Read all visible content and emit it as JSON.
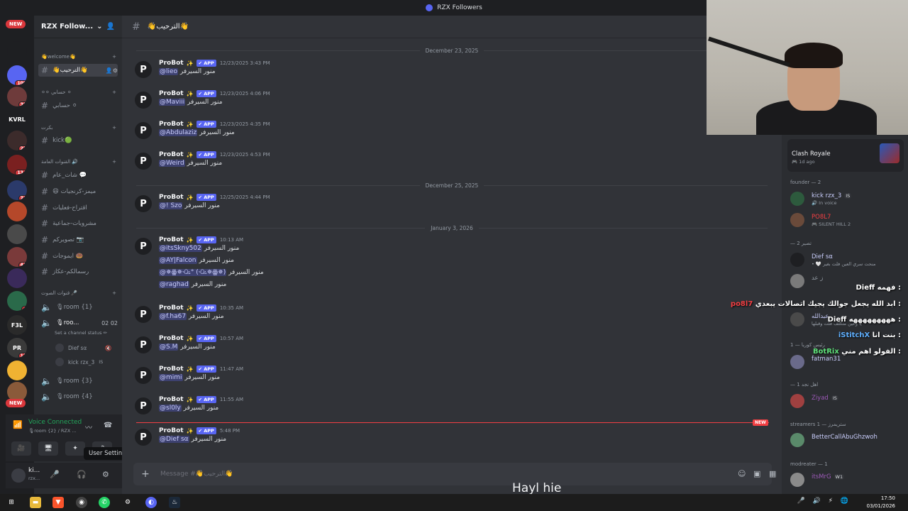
{
  "window": {
    "title": "RZX Followers"
  },
  "server": {
    "name": "RZX Follow...",
    "rail": [
      {
        "label": "NEW",
        "kind": "pill"
      },
      {
        "label": "",
        "badge": ""
      },
      {
        "label": "",
        "badge": "109"
      },
      {
        "label": "",
        "badge": "38"
      },
      {
        "label": "KVRL",
        "badge": ""
      },
      {
        "label": "",
        "badge": "25"
      },
      {
        "label": "",
        "badge": "134"
      },
      {
        "label": "",
        "badge": "72"
      },
      {
        "label": "",
        "badge": ""
      },
      {
        "label": "",
        "badge": ""
      },
      {
        "label": "",
        "badge": "42"
      },
      {
        "label": "",
        "badge": ""
      },
      {
        "label": "",
        "badge": "4"
      },
      {
        "label": "F3L",
        "badge": ""
      },
      {
        "label": "PR",
        "badge": "13"
      },
      {
        "label": "",
        "badge": ""
      },
      {
        "label": "",
        "badge": ""
      },
      {
        "label": "NEW",
        "kind": "pill"
      }
    ]
  },
  "sidebar": {
    "categories": {
      "welcome": "👋welcome👋",
      "cat2": "⚪⚪ حسابي ⚪",
      "cat3": "بكرت",
      "cat4": "القنوات العامة 🔊",
      "cat5": "قنوات الصوت 🎤"
    },
    "channels": {
      "welcome": "👋الترحيب👋",
      "acc": "حسابي ⚪",
      "kick": "kick🟢",
      "chat": "شات_عام 💬",
      "memes": "😆 ميمز-كرنجيات",
      "suggest": "اقتراح-فعليات",
      "games": "مشروبات-جماعية",
      "pics": "تصويركم 📷",
      "emotes": "ايموجات 🍩",
      "msgs": "رسمالكم-عكاز"
    },
    "voice": {
      "room1": "🎙room {1}",
      "room2": "🎙roo...",
      "room2_count_a": "02",
      "room2_count_b": "02",
      "room2_status": "Set a channel status ✏",
      "user_a": "Dief ѕα",
      "user_b": "kick rzx_3",
      "user_b_tag": "IS",
      "room3": "🎙room {3}",
      "room4": "🎙room {4}"
    },
    "voice_panel": {
      "title": "Voice Connected",
      "subtitle": "🎙room {2} / RZX ..."
    },
    "user_panel": {
      "name": "ki...",
      "sub": "rzx...",
      "tooltip": "User Settings"
    }
  },
  "chat": {
    "channel_name": "👋الترحيب👋",
    "dates": [
      "December 23, 2025",
      "December 25, 2025",
      "January 3, 2026"
    ],
    "author": "ProBot",
    "app_badge": "✔ APP",
    "sparkle": "✨",
    "suffix": "منور السيرفر",
    "messages": [
      {
        "time": "12/23/2025 3:43 PM",
        "lines": [
          "@lieo"
        ]
      },
      {
        "time": "12/23/2025 4:06 PM",
        "lines": [
          "@Maviii"
        ]
      },
      {
        "time": "12/23/2025 4:35 PM",
        "lines": [
          "@Abdulaziz"
        ]
      },
      {
        "time": "12/23/2025 4:53 PM",
        "lines": [
          "@Weird"
        ]
      },
      {
        "time": "12/25/2025 4:44 PM",
        "lines": [
          "@!      Szo"
        ]
      },
      {
        "time": "10:13 AM",
        "lines": [
          "@itsSkny502",
          "@AY|Falcon",
          "@✵ꙮ✵ꘐ° (ꘐ✵ꙮ✵)",
          "@raghad"
        ]
      },
      {
        "time": "10:35 AM",
        "lines": [
          "@f.ha67"
        ]
      },
      {
        "time": "10:57 AM",
        "lines": [
          "@S.M"
        ]
      },
      {
        "time": "11:47 AM",
        "lines": [
          "@mimi"
        ]
      },
      {
        "time": "11:55 AM",
        "lines": [
          "@sl0ly"
        ]
      },
      {
        "time": "5:48 PM",
        "lines": [
          "@Dief ѕα"
        ]
      }
    ],
    "new_tag": "NEW",
    "input_placeholder": "Message #👋الترحيب👋"
  },
  "members": {
    "activity": {
      "title": "Clash Royale",
      "sub": "🎮 1d ago"
    },
    "groups": [
      {
        "label": "founder — 2"
      },
      {
        "label": "— 2 تصير"
      },
      {
        "label": "رئيس كوريا — 1"
      },
      {
        "label": "— 1 اهل نجد"
      },
      {
        "label": "streamers 1 — ستريمرز"
      },
      {
        "label": "modreater — 1"
      }
    ],
    "list": [
      {
        "name": "kick rzx_3",
        "tag": "IS",
        "status": "🔊 In voice",
        "color": "#c9cdfb"
      },
      {
        "name": "PO8L7",
        "tag": "",
        "status": "🎮 SILENT HILL 2",
        "color": "#f23f43"
      },
      {
        "name": "Dief ѕα",
        "tag": "",
        "status": "• 🤍 منحت سري العين فلت بغير",
        "color": "#c9cdfb"
      },
      {
        "name": "ز عد",
        "tag": "",
        "status": "",
        "color": "#949ba4"
      },
      {
        "name": "عبدالله",
        "tag": "",
        "status": "يا وعين متكلف فلت وقبلها",
        "color": "#c9cdfb"
      },
      {
        "name": "fatman31",
        "tag": "",
        "status": "",
        "color": "#c9cdfb"
      },
      {
        "name": "Ziyad",
        "tag": "IS",
        "status": "",
        "color": "#9b59b6"
      },
      {
        "name": "BetterCallAbuGhzwoh",
        "tag": "",
        "status": "",
        "color": "#c9cdfb"
      },
      {
        "name": "itsMrG",
        "tag": "W1",
        "status": "",
        "color": "#9b59b6"
      }
    ]
  },
  "overlay": {
    "lines": [
      {
        "user": "Dieff",
        "text": "فهمه :"
      },
      {
        "user": "po8l7",
        "text": "ابد الله يجعل جوالك يجيك اتصالات يبعدي :"
      },
      {
        "user": "Dieff",
        "text": "هههههههههه :"
      },
      {
        "user": "iStitchX",
        "text": "بنت انا :"
      },
      {
        "user": "BotRix",
        "text": "الفولو اهم مني :"
      }
    ]
  },
  "caption": "Hayl hie",
  "taskbar": {
    "time": "17:50",
    "date": "03/01/2026"
  },
  "colors": {
    "accent": "#5865f2",
    "voice_green": "#23a55a",
    "danger": "#f23f43"
  }
}
